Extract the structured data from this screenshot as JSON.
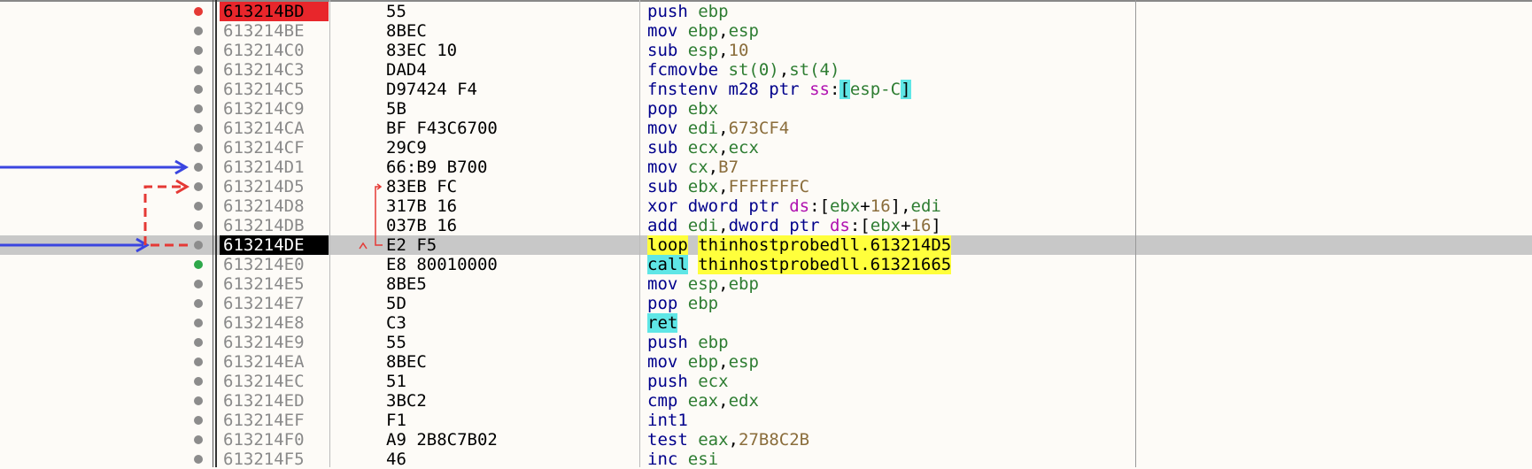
{
  "rows": [
    {
      "addr": "613214BD",
      "bytes": "55",
      "marker": "breakpoint",
      "addr_style": "bp",
      "asm": [
        {
          "t": "push",
          "c": "mn"
        },
        {
          "t": " "
        },
        {
          "t": "ebp",
          "c": "reg"
        }
      ]
    },
    {
      "addr": "613214BE",
      "bytes": "8BEC",
      "asm": [
        {
          "t": "mov",
          "c": "mn"
        },
        {
          "t": " "
        },
        {
          "t": "ebp",
          "c": "reg"
        },
        {
          "t": ","
        },
        {
          "t": "esp",
          "c": "reg"
        }
      ]
    },
    {
      "addr": "613214C0",
      "bytes": "83EC 10",
      "asm": [
        {
          "t": "sub",
          "c": "mn"
        },
        {
          "t": " "
        },
        {
          "t": "esp",
          "c": "reg"
        },
        {
          "t": ","
        },
        {
          "t": "10",
          "c": "num"
        }
      ]
    },
    {
      "addr": "613214C3",
      "bytes": "DAD4",
      "asm": [
        {
          "t": "fcmovbe",
          "c": "mn"
        },
        {
          "t": " "
        },
        {
          "t": "st(0)",
          "c": "reg"
        },
        {
          "t": ","
        },
        {
          "t": "st(4)",
          "c": "reg"
        }
      ]
    },
    {
      "addr": "613214C5",
      "bytes": "D97424 F4",
      "asm": [
        {
          "t": "fnstenv",
          "c": "mn"
        },
        {
          "t": " "
        },
        {
          "t": "m28 ptr",
          "c": "kw"
        },
        {
          "t": " "
        },
        {
          "t": "ss",
          "c": "seg"
        },
        {
          "t": ":"
        },
        {
          "t": "[",
          "c": "brk-hl"
        },
        {
          "t": "esp-C",
          "c": "reg"
        },
        {
          "t": "]",
          "c": "brk-hl"
        }
      ]
    },
    {
      "addr": "613214C9",
      "bytes": "5B",
      "asm": [
        {
          "t": "pop",
          "c": "mn"
        },
        {
          "t": " "
        },
        {
          "t": "ebx",
          "c": "reg"
        }
      ]
    },
    {
      "addr": "613214CA",
      "bytes": "BF F43C6700",
      "asm": [
        {
          "t": "mov",
          "c": "mn"
        },
        {
          "t": " "
        },
        {
          "t": "edi",
          "c": "reg"
        },
        {
          "t": ","
        },
        {
          "t": "673CF4",
          "c": "num"
        }
      ]
    },
    {
      "addr": "613214CF",
      "bytes": "29C9",
      "asm": [
        {
          "t": "sub",
          "c": "mn"
        },
        {
          "t": " "
        },
        {
          "t": "ecx",
          "c": "reg"
        },
        {
          "t": ","
        },
        {
          "t": "ecx",
          "c": "reg"
        }
      ]
    },
    {
      "addr": "613214D1",
      "bytes": "66:B9 B700",
      "asm": [
        {
          "t": "mov",
          "c": "mn"
        },
        {
          "t": " "
        },
        {
          "t": "cx",
          "c": "reg"
        },
        {
          "t": ","
        },
        {
          "t": "B7",
          "c": "num"
        }
      ]
    },
    {
      "addr": "613214D5",
      "bytes": "83EB FC",
      "asm": [
        {
          "t": "sub",
          "c": "mn"
        },
        {
          "t": " "
        },
        {
          "t": "ebx",
          "c": "reg"
        },
        {
          "t": ","
        },
        {
          "t": "FFFFFFFC",
          "c": "num"
        }
      ]
    },
    {
      "addr": "613214D8",
      "bytes": "317B 16",
      "asm": [
        {
          "t": "xor",
          "c": "mn"
        },
        {
          "t": " "
        },
        {
          "t": "dword ptr",
          "c": "kw"
        },
        {
          "t": " "
        },
        {
          "t": "ds",
          "c": "seg"
        },
        {
          "t": ":["
        },
        {
          "t": "ebx",
          "c": "reg"
        },
        {
          "t": "+"
        },
        {
          "t": "16",
          "c": "num"
        },
        {
          "t": "],"
        },
        {
          "t": "edi",
          "c": "reg"
        }
      ]
    },
    {
      "addr": "613214DB",
      "bytes": "037B 16",
      "asm": [
        {
          "t": "add",
          "c": "mn"
        },
        {
          "t": " "
        },
        {
          "t": "edi",
          "c": "reg"
        },
        {
          "t": ","
        },
        {
          "t": "dword ptr",
          "c": "kw"
        },
        {
          "t": " "
        },
        {
          "t": "ds",
          "c": "seg"
        },
        {
          "t": ":["
        },
        {
          "t": "ebx",
          "c": "reg"
        },
        {
          "t": "+"
        },
        {
          "t": "16",
          "c": "num"
        },
        {
          "t": "]"
        }
      ]
    },
    {
      "addr": "613214DE",
      "bytes": "E2 F5",
      "addr_style": "eip",
      "selected": true,
      "asm": [
        {
          "t": "loop",
          "c": "mn-hl"
        },
        {
          "t": " "
        },
        {
          "t": "thinhostprobedll.613214D5",
          "c": "lbl-hl"
        }
      ]
    },
    {
      "addr": "613214E0",
      "bytes": "E8 80010000",
      "marker": "green",
      "asm": [
        {
          "t": "call",
          "c": "mn-call"
        },
        {
          "t": " "
        },
        {
          "t": "thinhostprobedll.61321665",
          "c": "lbl-hl"
        }
      ]
    },
    {
      "addr": "613214E5",
      "bytes": "8BE5",
      "asm": [
        {
          "t": "mov",
          "c": "mn"
        },
        {
          "t": " "
        },
        {
          "t": "esp",
          "c": "reg"
        },
        {
          "t": ","
        },
        {
          "t": "ebp",
          "c": "reg"
        }
      ]
    },
    {
      "addr": "613214E7",
      "bytes": "5D",
      "asm": [
        {
          "t": "pop",
          "c": "mn"
        },
        {
          "t": " "
        },
        {
          "t": "ebp",
          "c": "reg"
        }
      ]
    },
    {
      "addr": "613214E8",
      "bytes": "C3",
      "asm": [
        {
          "t": "ret",
          "c": "mn-call"
        }
      ]
    },
    {
      "addr": "613214E9",
      "bytes": "55",
      "asm": [
        {
          "t": "push",
          "c": "mn"
        },
        {
          "t": " "
        },
        {
          "t": "ebp",
          "c": "reg"
        }
      ]
    },
    {
      "addr": "613214EA",
      "bytes": "8BEC",
      "asm": [
        {
          "t": "mov",
          "c": "mn"
        },
        {
          "t": " "
        },
        {
          "t": "ebp",
          "c": "reg"
        },
        {
          "t": ","
        },
        {
          "t": "esp",
          "c": "reg"
        }
      ]
    },
    {
      "addr": "613214EC",
      "bytes": "51",
      "asm": [
        {
          "t": "push",
          "c": "mn"
        },
        {
          "t": " "
        },
        {
          "t": "ecx",
          "c": "reg"
        }
      ]
    },
    {
      "addr": "613214ED",
      "bytes": "3BC2",
      "asm": [
        {
          "t": "cmp",
          "c": "mn"
        },
        {
          "t": " "
        },
        {
          "t": "eax",
          "c": "reg"
        },
        {
          "t": ","
        },
        {
          "t": "edx",
          "c": "reg"
        }
      ]
    },
    {
      "addr": "613214EF",
      "bytes": "F1",
      "asm": [
        {
          "t": "int1",
          "c": "mn"
        }
      ]
    },
    {
      "addr": "613214F0",
      "bytes": "A9 2B8C7B02",
      "asm": [
        {
          "t": "test",
          "c": "mn"
        },
        {
          "t": " "
        },
        {
          "t": "eax",
          "c": "reg"
        },
        {
          "t": ","
        },
        {
          "t": "27B8C2B",
          "c": "num"
        }
      ]
    },
    {
      "addr": "613214F5",
      "bytes": "46",
      "asm": [
        {
          "t": "inc",
          "c": "mn"
        },
        {
          "t": " "
        },
        {
          "t": "esi",
          "c": "reg"
        }
      ]
    }
  ],
  "colors": {
    "jump_arrow": "#3a45e0",
    "loop_arrow": "#e53935"
  }
}
